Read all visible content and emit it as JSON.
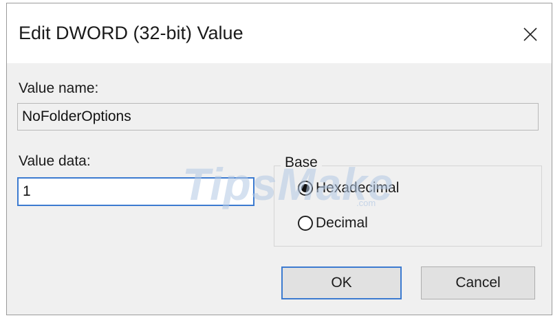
{
  "dialog": {
    "title": "Edit DWORD (32-bit) Value",
    "close_icon": "close-icon"
  },
  "value_name": {
    "label": "Value name:",
    "value": "NoFolderOptions"
  },
  "value_data": {
    "label": "Value data:",
    "value": "1"
  },
  "base": {
    "legend": "Base",
    "options": [
      {
        "label": "Hexadecimal",
        "checked": true
      },
      {
        "label": "Decimal",
        "checked": false
      }
    ]
  },
  "buttons": {
    "ok": "OK",
    "cancel": "Cancel"
  },
  "watermark": {
    "text": "TipsMake",
    "sub": ".com"
  },
  "colors": {
    "focus_border": "#3b7ad0",
    "dialog_bg": "#f0f0f0",
    "button_bg": "#e1e1e1"
  }
}
